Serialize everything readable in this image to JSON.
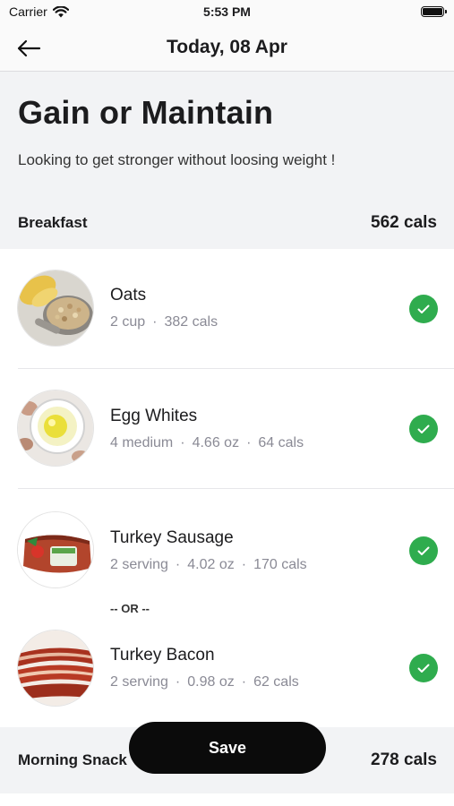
{
  "status_bar": {
    "carrier": "Carrier",
    "time": "5:53 PM"
  },
  "nav": {
    "title": "Today, 08 Apr",
    "back_icon": "arrow-left-icon"
  },
  "plan": {
    "title": "Gain or Maintain",
    "subtitle": "Looking to get stronger without loosing weight !"
  },
  "breakfast": {
    "name": "Breakfast",
    "cals": "562 cals",
    "items": [
      {
        "name": "Oats",
        "meta": [
          "2 cup",
          "382 cals"
        ],
        "checked": true
      },
      {
        "name": "Egg Whites",
        "meta": [
          "4 medium",
          "4.66 oz",
          "64 cals"
        ],
        "checked": true
      },
      {
        "name": "Turkey Sausage",
        "meta": [
          "2 serving",
          "4.02 oz",
          "170 cals"
        ],
        "checked": true
      },
      {
        "name": "Turkey Bacon",
        "meta": [
          "2 serving",
          "0.98 oz",
          "62 cals"
        ],
        "checked": true
      }
    ],
    "or_label": "-- OR --"
  },
  "morning_snack": {
    "name": "Morning Snack",
    "cals": "278 cals"
  },
  "save_label": "Save",
  "colors": {
    "accent_check": "#2fac4e",
    "save_button": "#0b0b0b",
    "background": "#f2f3f5"
  }
}
